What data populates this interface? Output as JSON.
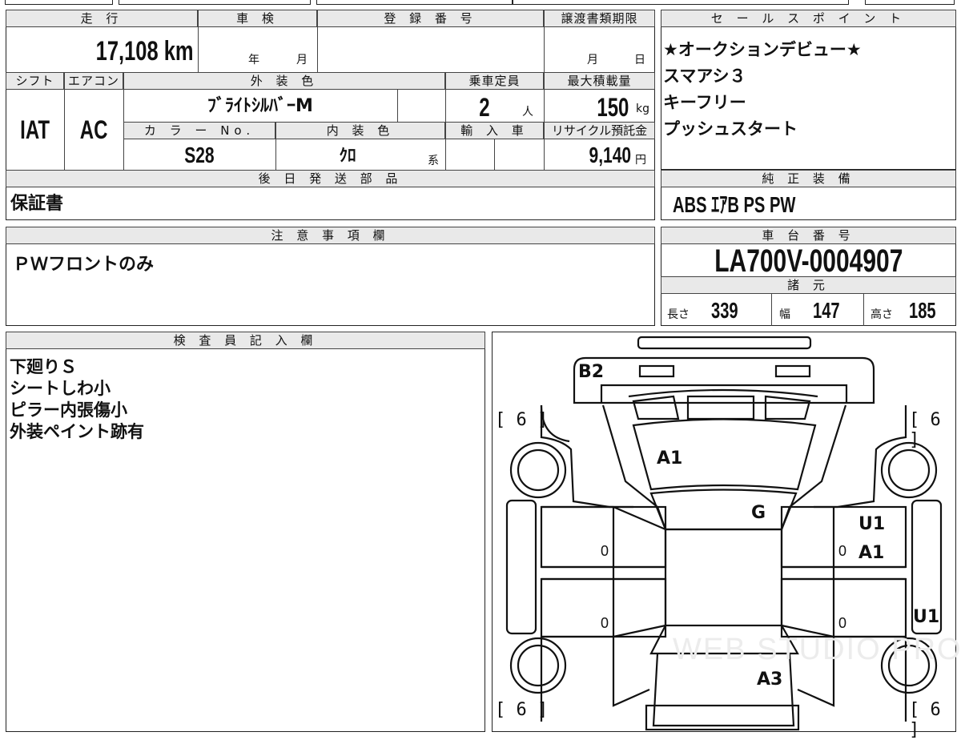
{
  "basic": {
    "mileage_label": "走 行",
    "mileage_value": "17,108 km",
    "inspection_label": "車 検",
    "inspection_year": "年",
    "inspection_month": "月",
    "reg_label": "登 録 番 号",
    "transfer_label": "譲渡書類期限",
    "transfer_month": "月",
    "transfer_day": "日",
    "shift_label": "シフト",
    "shift_value": "IAT",
    "ac_label": "エアコン",
    "ac_value": "AC",
    "exterior_label": "外 装 色",
    "exterior_value": "ﾌﾞﾗｲﾄｼﾙﾊﾞｰM",
    "capacity_label": "乗車定員",
    "capacity_value": "2",
    "capacity_unit": "人",
    "maxload_label": "最大積載量",
    "maxload_value": "150",
    "maxload_unit": "kg",
    "color_no_label": "カ ラ ー No.",
    "color_no_value": "S28",
    "interior_label": "内 装 色",
    "interior_value": "ｸﾛ",
    "interior_suffix": "系",
    "import_label": "輸 入 車",
    "recycle_label": "リサイクル預託金",
    "recycle_value": "9,140",
    "recycle_unit": "円",
    "later_label": "後 日 発 送 部 品",
    "later_value": "保証書"
  },
  "sales": {
    "label": "セ ー ル ス ポ イ ン ト",
    "points": [
      "★オークションデビュー★",
      "スマアシ３",
      "キーフリー",
      "プッシュスタート"
    ]
  },
  "equipment": {
    "label": "純 正 装 備",
    "value": "ABS ｴｱB PS PW"
  },
  "notes": {
    "label": "注 意 事 項 欄",
    "value": "ＰＷフロントのみ"
  },
  "chassis": {
    "label": "車 台 番 号",
    "value": "LA700V-0004907",
    "spec_label": "諸 元",
    "length_label": "長さ",
    "length_value": "339",
    "width_label": "幅",
    "width_value": "147",
    "height_label": "高さ",
    "height_value": "185"
  },
  "inspector": {
    "label": "検 査 員 記 入 欄",
    "lines": [
      "下廻りＳ",
      "シートしわ小",
      "ピラー内張傷小",
      "外装ペイント跡有"
    ]
  },
  "diagram": {
    "tire_tl": "[ 6 ]",
    "tire_tr": "[ 6 ]",
    "tire_bl": "[ 6 ]",
    "tire_br": "[ 6 ]",
    "marks": {
      "b2": "B2",
      "a1_hood": "A1",
      "g": "G",
      "u1_door": "U1",
      "a1_door": "A1",
      "u1_side": "U1",
      "a3": "A3"
    },
    "zeros": [
      "0",
      "0",
      "0",
      "0"
    ],
    "watermark": "WEB STUDIO PRO"
  }
}
